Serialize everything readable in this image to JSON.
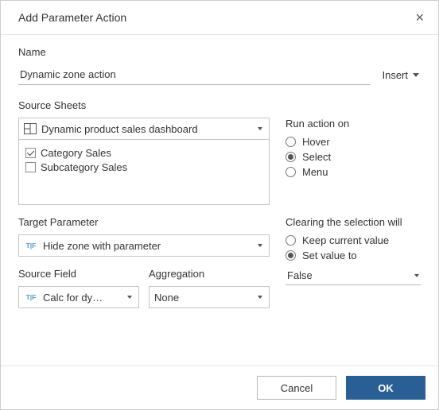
{
  "dialog": {
    "title": "Add Parameter Action",
    "close": "×"
  },
  "name": {
    "label": "Name",
    "value": "Dynamic zone action",
    "insert": "Insert"
  },
  "source_sheets": {
    "label": "Source Sheets",
    "dashboard": "Dynamic product sales dashboard",
    "sheets": [
      {
        "label": "Category Sales",
        "checked": true
      },
      {
        "label": "Subcategory Sales",
        "checked": false
      }
    ]
  },
  "run_on": {
    "label": "Run action on",
    "options": [
      "Hover",
      "Select",
      "Menu"
    ],
    "selected": "Select"
  },
  "target": {
    "label": "Target Parameter",
    "value": "Hide zone with parameter"
  },
  "clearing": {
    "label": "Clearing the selection will",
    "options": [
      "Keep current value",
      "Set value to"
    ],
    "selected": "Set value to",
    "set_value": "False"
  },
  "source_field": {
    "label": "Source Field",
    "value": "Calc for dy…"
  },
  "aggregation": {
    "label": "Aggregation",
    "value": "None"
  },
  "footer": {
    "cancel": "Cancel",
    "ok": "OK"
  }
}
